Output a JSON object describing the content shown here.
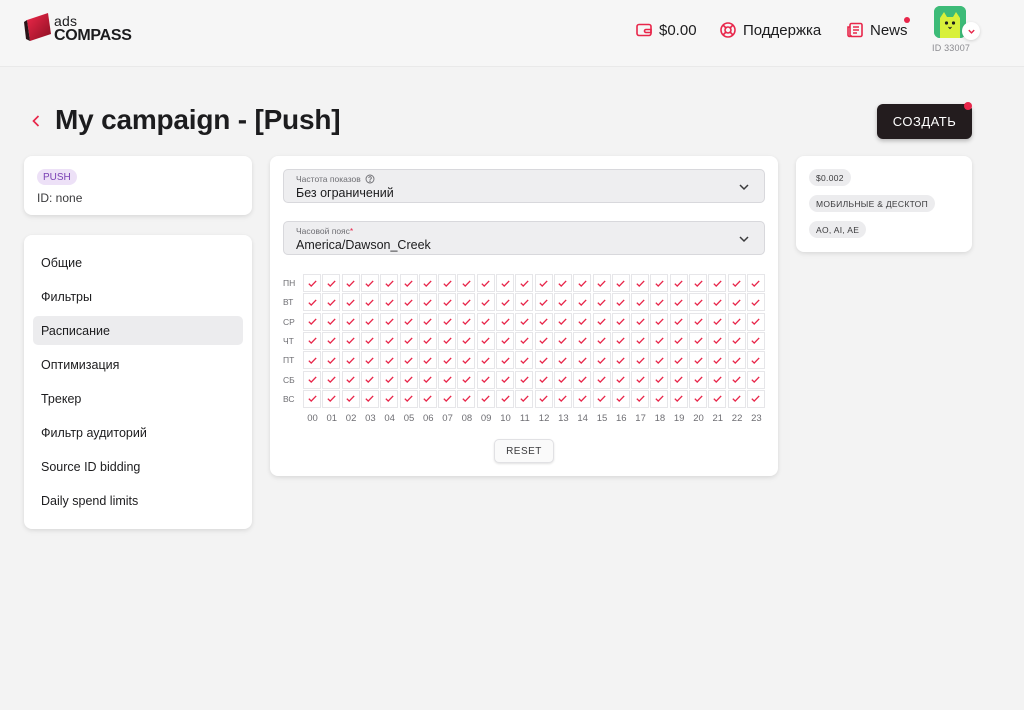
{
  "header": {
    "logo_ads": "ads",
    "logo_compass": "COMPASS",
    "balance": "$0.00",
    "support": "Поддержка",
    "news": "News",
    "user_id": "ID 33007"
  },
  "page": {
    "title": "My campaign - [Push]",
    "create_button": "СОЗДАТЬ"
  },
  "campaign_card": {
    "badge": "PUSH",
    "id": "ID: none"
  },
  "nav": {
    "items": [
      "Общие",
      "Фильтры",
      "Расписание",
      "Оптимизация",
      "Трекер",
      "Фильтр аудиторий",
      "Source ID bidding",
      "Daily spend limits"
    ],
    "active_index": 2
  },
  "schedule": {
    "frequency_label": "Частота показов",
    "frequency_value": "Без ограничений",
    "timezone_label": "Часовой пояс",
    "timezone_required": "*",
    "timezone_value": "America/Dawson_Creek",
    "days": [
      "ПН",
      "ВТ",
      "СР",
      "ЧТ",
      "ПТ",
      "СБ",
      "ВС"
    ],
    "hours": [
      "00",
      "01",
      "02",
      "03",
      "04",
      "05",
      "06",
      "07",
      "08",
      "09",
      "10",
      "11",
      "12",
      "13",
      "14",
      "15",
      "16",
      "17",
      "18",
      "19",
      "20",
      "21",
      "22",
      "23"
    ],
    "all_selected": true,
    "reset_label": "RESET"
  },
  "info": {
    "price": "$0.002",
    "platform": "МОБИЛЬНЫЕ & ДЕСКТОП",
    "countries": "AO, AI, AE"
  },
  "colors": {
    "accent": "#e8264a",
    "dark_button": "#231c1e"
  }
}
